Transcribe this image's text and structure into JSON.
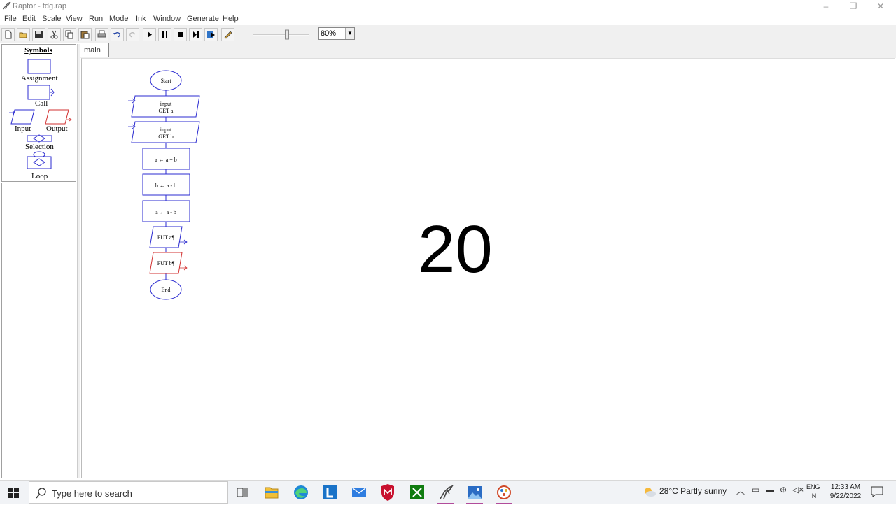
{
  "window": {
    "title": "Raptor - fdg.rap",
    "controls": {
      "minimize": "–",
      "maximize": "❐",
      "close": "✕"
    }
  },
  "menu": [
    "File",
    "Edit",
    "Scale",
    "View",
    "Run",
    "Mode",
    "Ink",
    "Window",
    "Generate",
    "Help"
  ],
  "toolbar": {
    "buttons": [
      "new-icon",
      "open-icon",
      "save-icon",
      "cut-icon",
      "copy-icon",
      "paste-icon",
      "print-icon",
      "undo-icon",
      "redo-icon",
      "play-icon",
      "pause-icon",
      "stop-icon",
      "step-icon",
      "test-icon",
      "ink-pen-icon"
    ],
    "zoom": "80%",
    "zoom_slider_fraction": 0.6
  },
  "symbols": {
    "header": "Symbols",
    "items": {
      "assignment": "Assignment",
      "call": "Call",
      "input": "Input",
      "output": "Output",
      "selection": "Selection",
      "loop": "Loop"
    }
  },
  "tabs": [
    "main"
  ],
  "flowchart": {
    "start": "Start",
    "input_a": {
      "line1": "input",
      "line2": "GET a"
    },
    "input_b": {
      "line1": "input",
      "line2": "GET b"
    },
    "assign1": "a ← a + b",
    "assign2": "b ← a - b",
    "assign3": "a ← a - b",
    "output_a": "PUT a¶",
    "output_b": "PUT b¶",
    "end": "End"
  },
  "overlay_number": "20",
  "taskbar": {
    "search_placeholder": "Type here to search",
    "apps": [
      "task-view-icon",
      "file-explorer-icon",
      "edge-icon",
      "l-app-icon",
      "mail-icon",
      "mcafee-icon",
      "xbox-icon",
      "raptor-icon",
      "photos-icon",
      "paint-icon"
    ],
    "weather": "28°C  Partly sunny",
    "lang_line1": "ENG",
    "lang_line2": "IN",
    "time": "12:33 AM",
    "date": "9/22/2022"
  },
  "colors": {
    "flow_blue": "#2b2bd0",
    "flow_red": "#d23030",
    "accent": "#b14c9b"
  }
}
